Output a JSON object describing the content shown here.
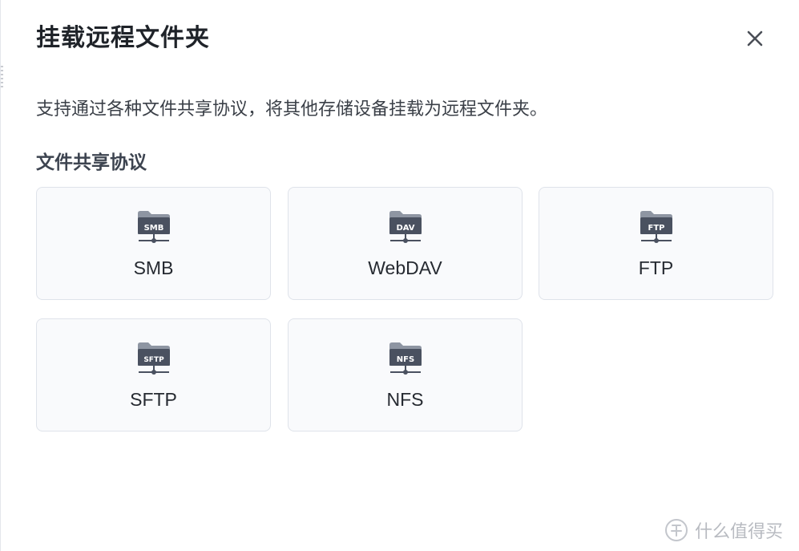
{
  "dialog": {
    "title": "挂载远程文件夹",
    "close_icon": "close-icon",
    "description": "支持通过各种文件共享协议，将其他存储设备挂载为远程文件夹。"
  },
  "protocols": {
    "section_title": "文件共享协议",
    "items": [
      {
        "label": "SMB",
        "icon_text": "SMB",
        "icon": "smb-folder-icon"
      },
      {
        "label": "WebDAV",
        "icon_text": "DAV",
        "icon": "webdav-folder-icon"
      },
      {
        "label": "FTP",
        "icon_text": "FTP",
        "icon": "ftp-folder-icon"
      },
      {
        "label": "SFTP",
        "icon_text": "SFTP",
        "icon": "sftp-folder-icon"
      },
      {
        "label": "NFS",
        "icon_text": "NFS",
        "icon": "nfs-folder-icon"
      }
    ]
  },
  "watermark": {
    "text": "什么值得买",
    "icon": "zhi-logo-icon"
  },
  "colors": {
    "card_border": "#dfe3ea",
    "card_background": "#f9fafc",
    "icon_dark": "#4a5160",
    "icon_light": "#8e95a2"
  }
}
